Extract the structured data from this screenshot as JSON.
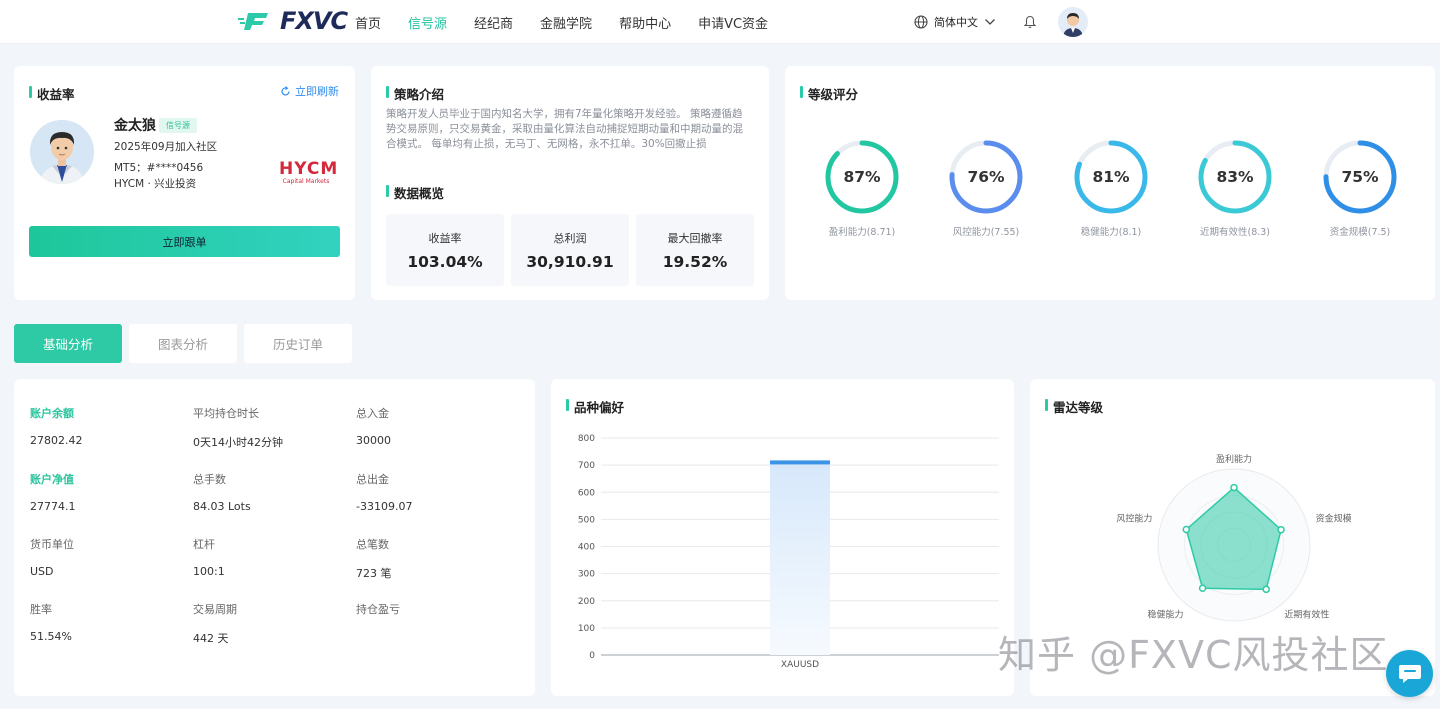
{
  "header": {
    "logo_text": "FXVC",
    "nav": [
      {
        "label": "首页",
        "active": false
      },
      {
        "label": "信号源",
        "active": true
      },
      {
        "label": "经纪商",
        "active": false
      },
      {
        "label": "金融学院",
        "active": false
      },
      {
        "label": "帮助中心",
        "active": false
      },
      {
        "label": "申请VC资金",
        "active": false
      }
    ],
    "language": "简体中文"
  },
  "profile": {
    "section_title": "收益率",
    "refresh_label": "立即刷新",
    "name": "金太狼",
    "badge": "信号源",
    "joined": "2025年09月加入社区",
    "mt5": "MT5：#****0456",
    "broker": "HYCM · 兴业投资",
    "broker_logo_main": "HYCM",
    "broker_logo_sub": "Capital Markets",
    "follow_label": "立即跟单"
  },
  "strategy": {
    "title": "策略介绍",
    "text": "策略开发人员毕业于国内知名大学，拥有7年量化策略开发经验。 策略遵循趋势交易原则，只交易黄金，采取由量化算法自动捕捉短期动量和中期动量的混合模式。 每单均有止损，无马丁、无网格，永不扛单。30%回撤止损",
    "overview_title": "数据概览",
    "stats": [
      {
        "label": "收益率",
        "value": "103.04%"
      },
      {
        "label": "总利润",
        "value": "30,910.91"
      },
      {
        "label": "最大回撤率",
        "value": "19.52%"
      }
    ]
  },
  "rating": {
    "title": "等级评分",
    "items": [
      {
        "value": "87%",
        "pct": 87,
        "label": "盈利能力(8.71)",
        "color": "#22c7a1"
      },
      {
        "value": "76%",
        "pct": 76,
        "label": "风控能力(7.55)",
        "color": "#5b8def"
      },
      {
        "value": "81%",
        "pct": 81,
        "label": "稳健能力(8.1)",
        "color": "#39b8ea"
      },
      {
        "value": "83%",
        "pct": 83,
        "label": "近期有效性(8.3)",
        "color": "#3cc9d6"
      },
      {
        "value": "75%",
        "pct": 75,
        "label": "资金规模(7.5)",
        "color": "#2f8fe6"
      }
    ]
  },
  "tabs": [
    {
      "label": "基础分析",
      "active": true
    },
    {
      "label": "图表分析",
      "active": false
    },
    {
      "label": "历史订单",
      "active": false
    }
  ],
  "basic": {
    "fields": [
      {
        "key": "账户余额",
        "value": "27802.42",
        "highlight": true
      },
      {
        "key": "平均持仓时长",
        "value": "0天14小时42分钟",
        "highlight": false
      },
      {
        "key": "总入金",
        "value": "30000",
        "highlight": false
      },
      {
        "key": "账户净值",
        "value": "27774.1",
        "highlight": true
      },
      {
        "key": "总手数",
        "value": "84.03 Lots",
        "highlight": false
      },
      {
        "key": "总出金",
        "value": "-33109.07",
        "highlight": false
      },
      {
        "key": "货币单位",
        "value": "USD",
        "highlight": false
      },
      {
        "key": "杠杆",
        "value": "100:1",
        "highlight": false
      },
      {
        "key": "总笔数",
        "value": "723 笔",
        "highlight": false
      },
      {
        "key": "胜率",
        "value": "51.54%",
        "highlight": false
      },
      {
        "key": "交易周期",
        "value": "442 天",
        "highlight": false
      },
      {
        "key": "持仓盈亏",
        "value": "",
        "highlight": false
      }
    ]
  },
  "variety": {
    "title": "品种偏好"
  },
  "radar": {
    "title": "雷达等级"
  },
  "chart_data": [
    {
      "type": "bar",
      "categories": [
        "XAUUSD"
      ],
      "values": [
        710
      ],
      "ylim": [
        0,
        800
      ],
      "yticks": [
        0,
        100,
        200,
        300,
        400,
        500,
        600,
        700,
        800
      ],
      "grid": true
    },
    {
      "type": "radar",
      "axes": [
        "盈利能力",
        "资金规模",
        "近期有效性",
        "稳健能力",
        "风控能力"
      ],
      "values": [
        0.87,
        0.75,
        0.83,
        0.81,
        0.76
      ],
      "max": 1
    }
  ],
  "watermark": "知乎 @FXVC风投社区",
  "colors": {
    "accent": "#2ecaa6",
    "link": "#2f8cf0"
  }
}
